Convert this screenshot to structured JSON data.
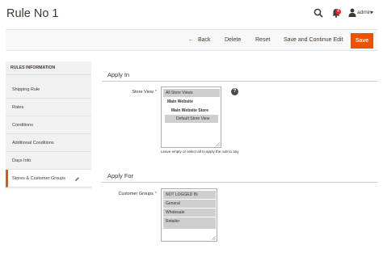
{
  "header": {
    "title": "Rule No 1",
    "notification_count": "4",
    "user": "admin"
  },
  "actions": {
    "back": "Back",
    "delete": "Delete",
    "reset": "Reset",
    "save_continue": "Save and Continue Edit",
    "save": "Save"
  },
  "sidebar": {
    "heading": "RULES INFORMATION",
    "items": [
      {
        "label": "Shipping Rule"
      },
      {
        "label": "Rates"
      },
      {
        "label": "Conditions"
      },
      {
        "label": "Additional Conditions"
      },
      {
        "label": "Days Info"
      },
      {
        "label": "Stores & Customer Groups"
      }
    ],
    "active_index": 5
  },
  "apply_in": {
    "title": "Apply In",
    "store_view_label": "Store View",
    "store_view_options": [
      {
        "label": "All Store Views",
        "selected": true
      },
      {
        "label": "Main Website",
        "selected": false
      },
      {
        "label": "Main Website Store",
        "selected": false
      },
      {
        "label": "Default Store View",
        "selected": true
      }
    ],
    "note": "Leave empty or select all to apply the rule to any"
  },
  "apply_for": {
    "title": "Apply For",
    "customer_groups_label": "Customer Groups",
    "customer_groups_options": [
      {
        "label": "NOT LOGGED IN",
        "selected": true
      },
      {
        "label": "General",
        "selected": true
      },
      {
        "label": "Wholesale",
        "selected": true
      },
      {
        "label": "Retailer",
        "selected": true
      }
    ]
  },
  "colors": {
    "accent": "#eb5202",
    "badge": "#e22626",
    "selected_option": "#cecece"
  },
  "icons": {
    "search": "search-icon",
    "notifications": "bell-icon",
    "user": "user-icon",
    "help": "help-icon",
    "edit": "pencil-icon"
  }
}
